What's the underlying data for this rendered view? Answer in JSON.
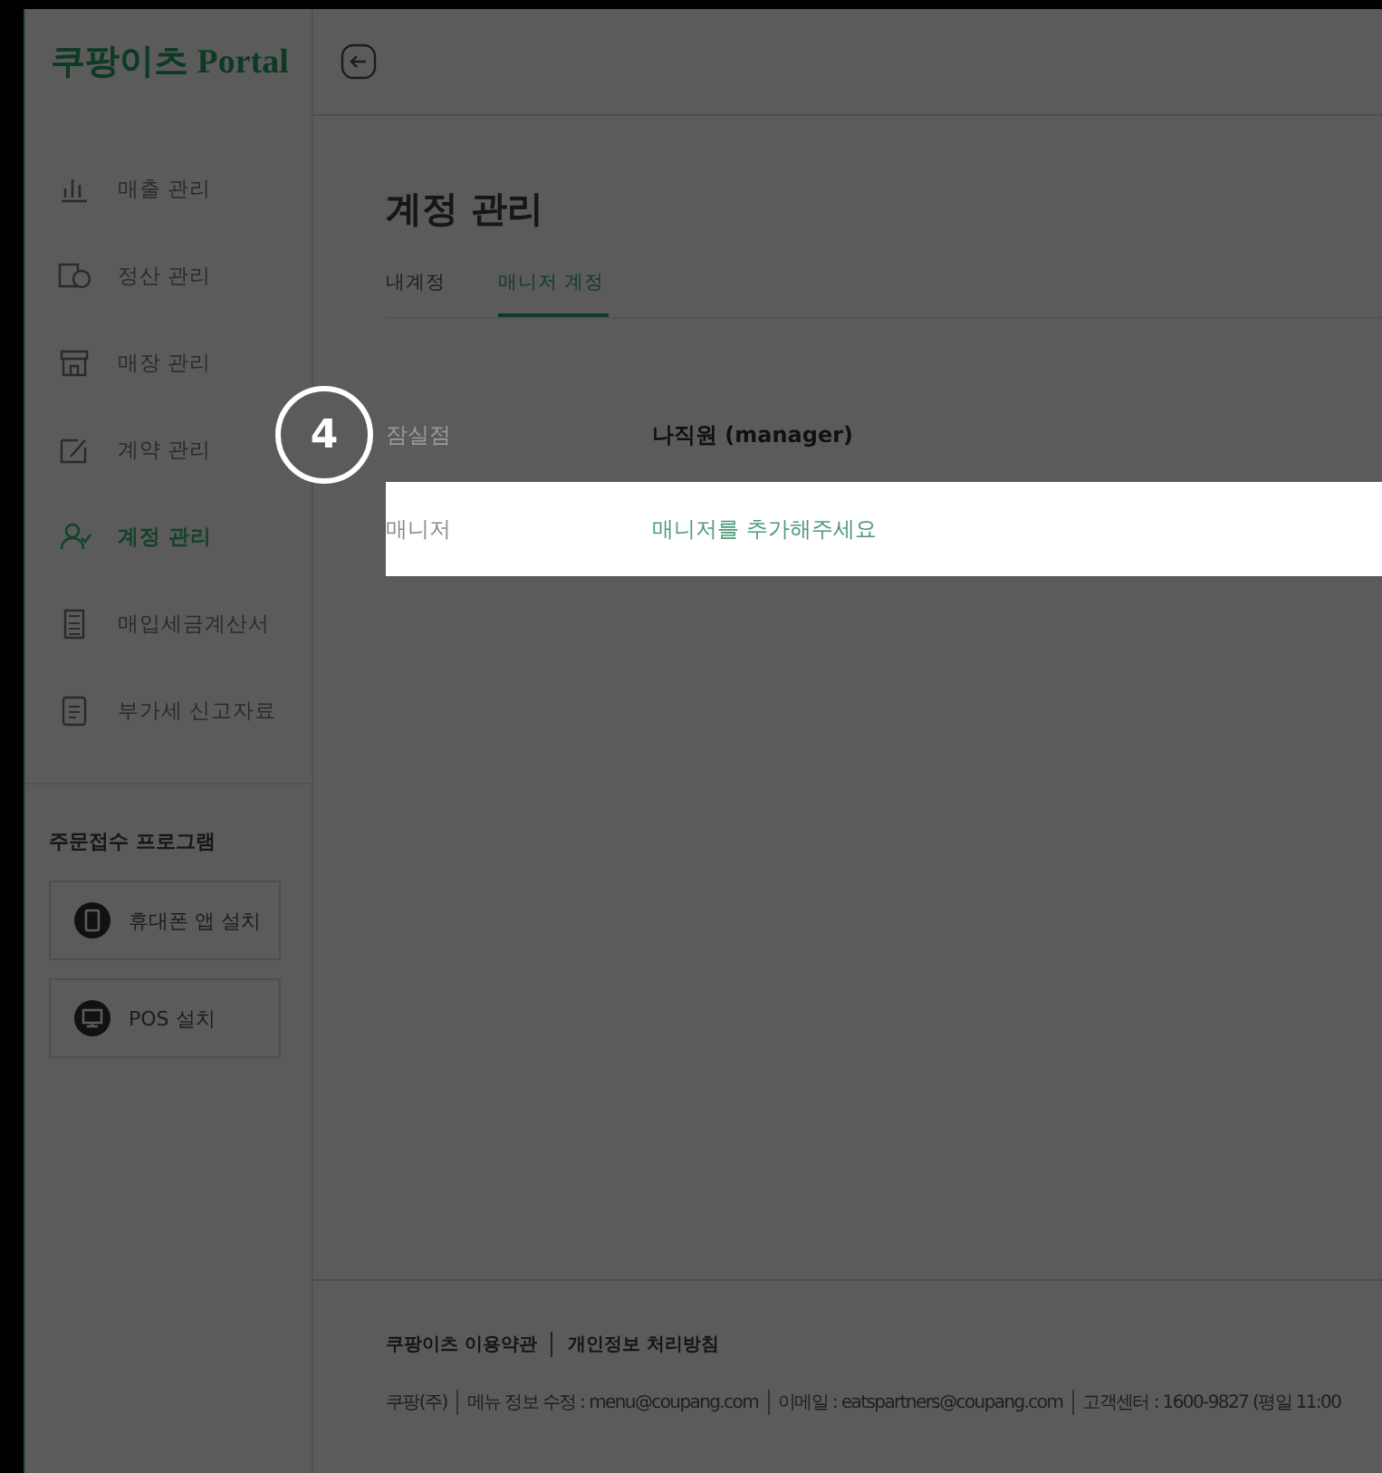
{
  "sidebar": {
    "logo": "쿠팡이츠 Portal",
    "items": [
      {
        "label": "매출 관리",
        "selected": false
      },
      {
        "label": "정산 관리",
        "selected": false
      },
      {
        "label": "매장 관리",
        "selected": false
      },
      {
        "label": "계약 관리",
        "selected": false
      },
      {
        "label": "계정 관리",
        "selected": true
      },
      {
        "label": "매입세금계산서",
        "selected": false
      },
      {
        "label": "부가세 신고자료",
        "selected": false
      }
    ],
    "section_title": "주문접수 프로그램",
    "install_buttons": [
      {
        "label": "휴대폰 앱 설치"
      },
      {
        "label": "POS 설치"
      }
    ]
  },
  "page": {
    "title": "계정 관리",
    "tabs": [
      {
        "label": "내계정",
        "selected": false
      },
      {
        "label": "매니저 계정",
        "selected": true
      }
    ],
    "rows": [
      {
        "label": "잠실점",
        "value": "나직원 (manager)",
        "kind": "account",
        "highlighted": false
      },
      {
        "label": "매니저",
        "value": "매니저를 추가해주세요",
        "kind": "add-link",
        "highlighted": true
      }
    ]
  },
  "callout": {
    "number": "4"
  },
  "footer": {
    "links": [
      "쿠팡이츠 이용약관",
      "개인정보 처리방침"
    ],
    "info": [
      "쿠팡(주)",
      "메뉴 정보 수정 : menu@coupang.com",
      "이메일 : eatspartners@coupang.com",
      "고객센터 : 1600-9827 (평일 11:00"
    ]
  }
}
